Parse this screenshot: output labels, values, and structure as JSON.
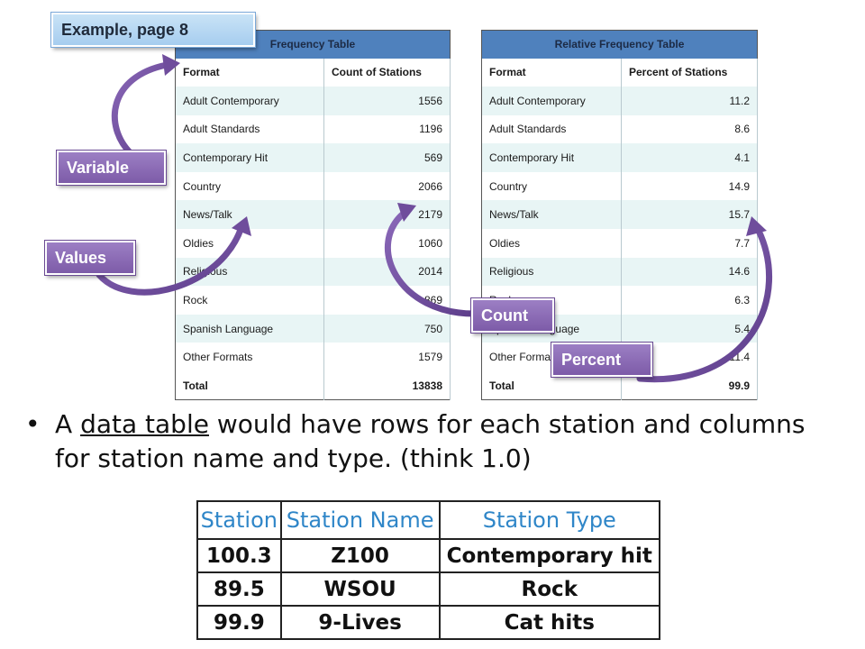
{
  "frequency_table": {
    "title": "Frequency Table",
    "headers": [
      "Format",
      "Count of Stations"
    ],
    "rows": [
      [
        "Adult Contemporary",
        "1556"
      ],
      [
        "Adult Standards",
        "1196"
      ],
      [
        "Contemporary Hit",
        "569"
      ],
      [
        "Country",
        "2066"
      ],
      [
        "News/Talk",
        "2179"
      ],
      [
        "Oldies",
        "1060"
      ],
      [
        "Religious",
        "2014"
      ],
      [
        "Rock",
        "869"
      ],
      [
        "Spanish Language",
        "750"
      ],
      [
        "Other Formats",
        "1579"
      ]
    ],
    "total": [
      "Total",
      "13838"
    ]
  },
  "relative_table": {
    "title": "Relative Frequency Table",
    "headers": [
      "Format",
      "Percent of Stations"
    ],
    "rows": [
      [
        "Adult Contemporary",
        "11.2"
      ],
      [
        "Adult Standards",
        "8.6"
      ],
      [
        "Contemporary Hit",
        "4.1"
      ],
      [
        "Country",
        "14.9"
      ],
      [
        "News/Talk",
        "15.7"
      ],
      [
        "Oldies",
        "7.7"
      ],
      [
        "Religious",
        "14.6"
      ],
      [
        "Rock",
        "6.3"
      ],
      [
        "Spanish Language",
        "5.4"
      ],
      [
        "Other Formats",
        "11.4"
      ]
    ],
    "total": [
      "Total",
      "99.9"
    ]
  },
  "callouts": {
    "example": "Example, page 8",
    "variable": "Variable",
    "values": "Values",
    "count": "Count",
    "percent": "Percent"
  },
  "bullet": {
    "before": "A ",
    "underlined": "data table",
    "after": " would have rows for each station and columns for station name and type. (think 1.0)"
  },
  "station_table": {
    "headers": [
      "Station",
      "Station Name",
      "Station Type"
    ],
    "rows": [
      [
        "100.3",
        "Z100",
        "Contemporary hit"
      ],
      [
        "89.5",
        "WSOU",
        "Rock"
      ],
      [
        "99.9",
        "9-Lives",
        "Cat hits"
      ]
    ]
  },
  "colors": {
    "table_title_bar": "#4f81bd",
    "table_stripe": "#e8f5f5",
    "arrow_purple": "#6f4d9c",
    "header_blue_text": "#2f86c8"
  }
}
